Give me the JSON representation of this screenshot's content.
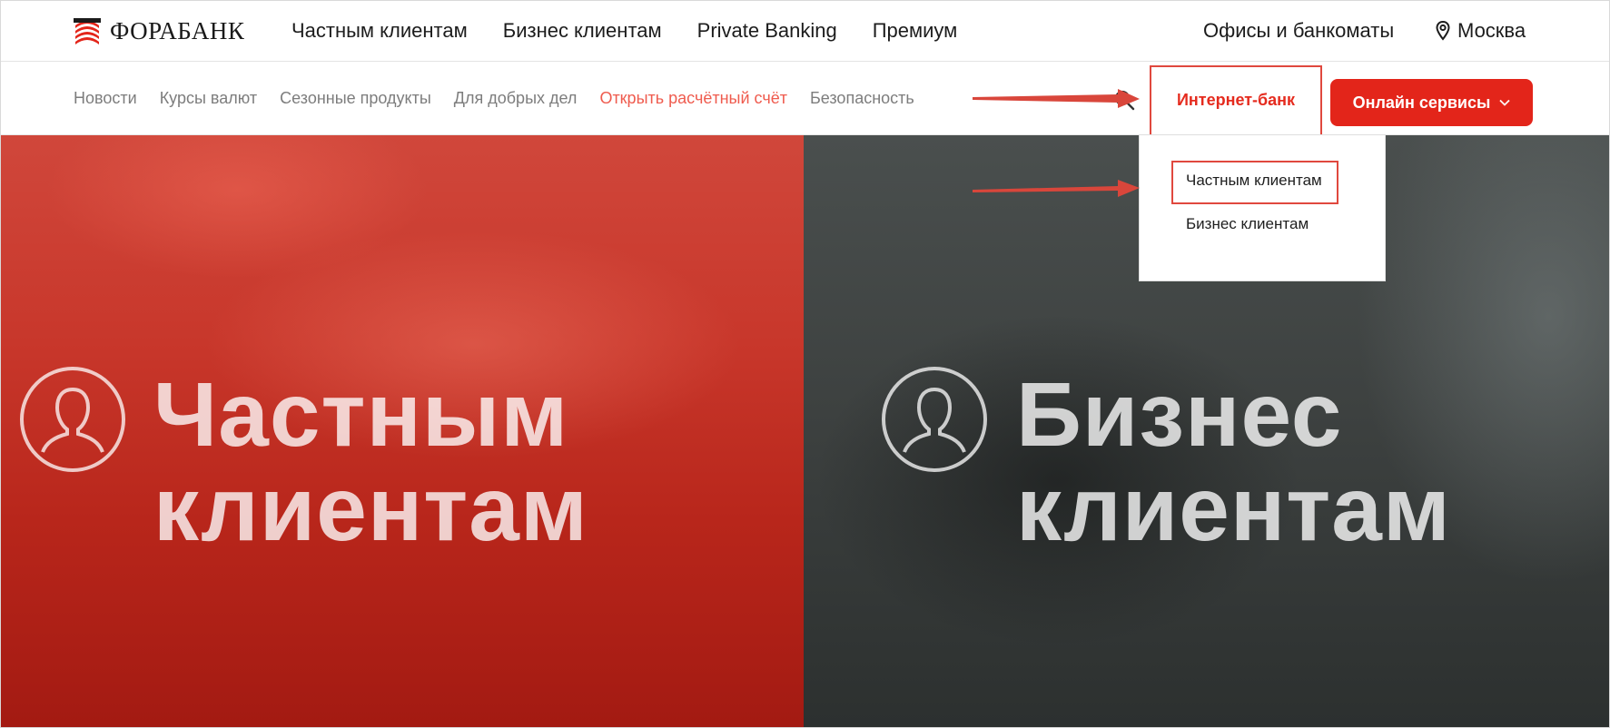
{
  "brand": {
    "name": "ФОРАБАНК"
  },
  "main_nav": [
    "Частным клиентам",
    "Бизнес клиентам",
    "Private Banking",
    "Премиум"
  ],
  "offices_label": "Офисы и банкоматы",
  "city": "Москва",
  "sub_nav": [
    {
      "label": "Новости",
      "accent": false
    },
    {
      "label": "Курсы валют",
      "accent": false
    },
    {
      "label": "Сезонные продукты",
      "accent": false
    },
    {
      "label": "Для добрых дел",
      "accent": false
    },
    {
      "label": "Открыть расчётный счёт",
      "accent": true
    },
    {
      "label": "Безопасность",
      "accent": false
    }
  ],
  "internet_bank_label": "Интернет-банк",
  "online_services_label": "Онлайн сервисы",
  "dropdown": {
    "items": [
      "Частным клиентам",
      "Бизнес клиентам"
    ],
    "highlighted": "Частным клиентам"
  },
  "hero": {
    "left": {
      "line1": "Частным",
      "line2": "клиентам"
    },
    "right": {
      "line1": "Бизнес",
      "line2": "клиентам"
    }
  },
  "colors": {
    "brand_red": "#e3251a",
    "annotation_red": "#e0483e",
    "accent_link": "#ef5b4e"
  },
  "icons": [
    "logo-mark-icon",
    "location-pin-icon",
    "search-icon",
    "chevron-down-icon",
    "user-circle-icon",
    "annotation-arrow-icon"
  ]
}
